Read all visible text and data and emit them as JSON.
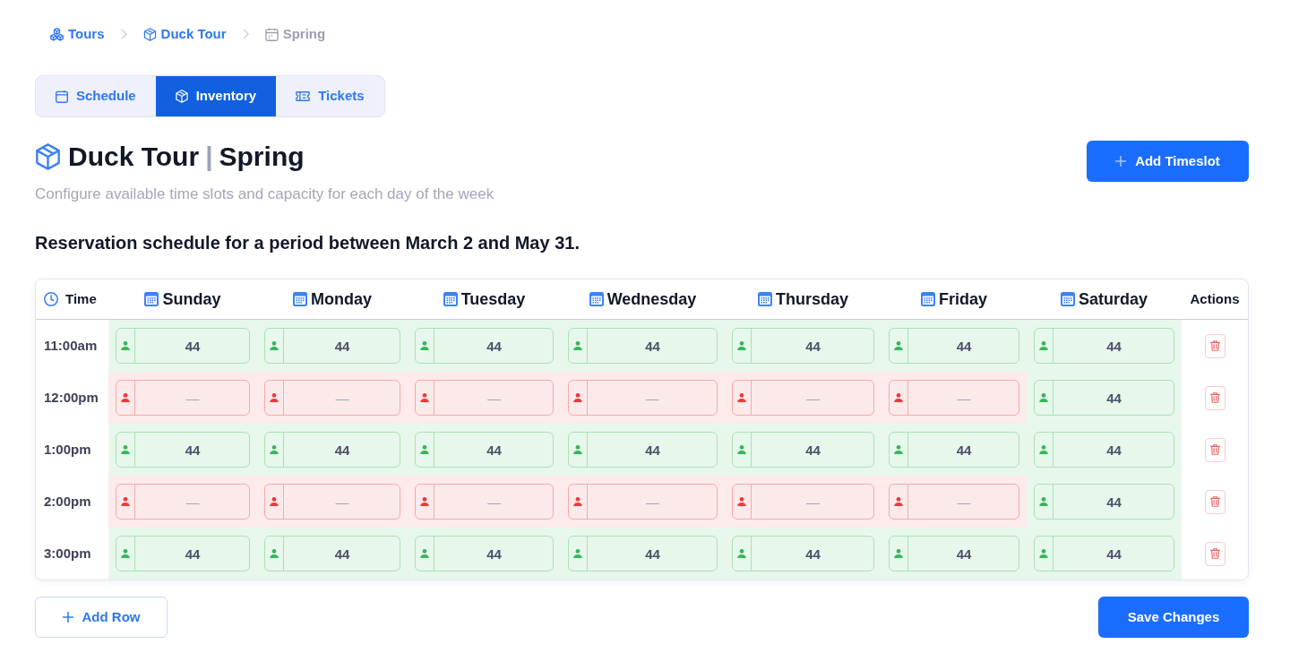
{
  "breadcrumb": [
    {
      "label": "Tours",
      "current": false
    },
    {
      "label": "Duck Tour",
      "current": false
    },
    {
      "label": "Spring",
      "current": true
    }
  ],
  "tabs": [
    {
      "label": "Schedule",
      "selected": false
    },
    {
      "label": "Inventory",
      "selected": true
    },
    {
      "label": "Tickets",
      "selected": false
    }
  ],
  "header": {
    "title": "Duck Tour",
    "separator": "|",
    "season": "Spring",
    "description": "Configure available time slots and capacity for each day of the week",
    "add_button": "Add Timeslot"
  },
  "period_heading": "Reservation schedule for a period between March 2 and May 31.",
  "table": {
    "columns": [
      "Time",
      "Sunday",
      "Monday",
      "Tuesday",
      "Wednesday",
      "Thursday",
      "Friday",
      "Saturday",
      "Actions"
    ],
    "rows": [
      {
        "time": "11:00am",
        "slots": [
          {
            "available": true,
            "value": "44"
          },
          {
            "available": true,
            "value": "44"
          },
          {
            "available": true,
            "value": "44"
          },
          {
            "available": true,
            "value": "44"
          },
          {
            "available": true,
            "value": "44"
          },
          {
            "available": true,
            "value": "44"
          },
          {
            "available": true,
            "value": "44"
          }
        ]
      },
      {
        "time": "12:00pm",
        "slots": [
          {
            "available": false,
            "placeholder": "—"
          },
          {
            "available": false,
            "placeholder": "—"
          },
          {
            "available": false,
            "placeholder": "—"
          },
          {
            "available": false,
            "placeholder": "—"
          },
          {
            "available": false,
            "placeholder": "—"
          },
          {
            "available": false,
            "placeholder": "—"
          },
          {
            "available": true,
            "value": "44"
          }
        ]
      },
      {
        "time": "1:00pm",
        "slots": [
          {
            "available": true,
            "value": "44"
          },
          {
            "available": true,
            "value": "44"
          },
          {
            "available": true,
            "value": "44"
          },
          {
            "available": true,
            "value": "44"
          },
          {
            "available": true,
            "value": "44"
          },
          {
            "available": true,
            "value": "44"
          },
          {
            "available": true,
            "value": "44"
          }
        ]
      },
      {
        "time": "2:00pm",
        "slots": [
          {
            "available": false,
            "placeholder": "—"
          },
          {
            "available": false,
            "placeholder": "—"
          },
          {
            "available": false,
            "placeholder": "—"
          },
          {
            "available": false,
            "placeholder": "—"
          },
          {
            "available": false,
            "placeholder": "—"
          },
          {
            "available": false,
            "placeholder": "—"
          },
          {
            "available": true,
            "value": "44"
          }
        ]
      },
      {
        "time": "3:00pm",
        "slots": [
          {
            "available": true,
            "value": "44"
          },
          {
            "available": true,
            "value": "44"
          },
          {
            "available": true,
            "value": "44"
          },
          {
            "available": true,
            "value": "44"
          },
          {
            "available": true,
            "value": "44"
          },
          {
            "available": true,
            "value": "44"
          },
          {
            "available": true,
            "value": "44"
          }
        ]
      }
    ]
  },
  "footer": {
    "add_row_button": "Add Row",
    "save_button": "Save Changes"
  }
}
